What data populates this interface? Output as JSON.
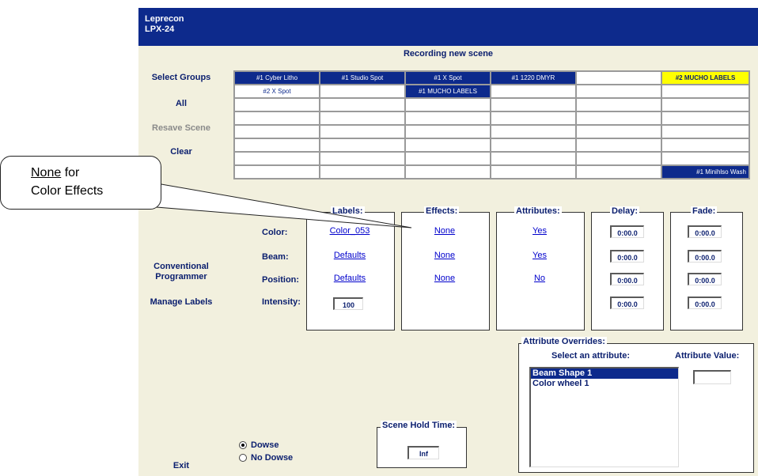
{
  "app": {
    "title_line1": "Leprecon",
    "title_line2": "LPX-24"
  },
  "status": "Recording new scene",
  "sidebar": {
    "select_groups": "Select Groups",
    "all": "All",
    "resave_scene": "Resave Scene",
    "clear": "Clear",
    "conventional_line1": "Conventional",
    "conventional_line2": "Programmer",
    "manage_labels": "Manage Labels",
    "exit": "Exit"
  },
  "groups": {
    "row1": [
      "#1 Cyber Litho",
      "#1 Studio Spot",
      "#1 X Spot",
      "#1 1220 DMYR",
      "",
      "#2 MUCHO LABELS"
    ],
    "row2": [
      "#2 X Spot",
      "",
      "#1 MUCHO LABELS",
      "",
      "",
      ""
    ],
    "last_row_last": "#1 Minihlso Wash"
  },
  "callout": {
    "underlined": "None",
    "line1_rest": " for",
    "line2": "Color Effects"
  },
  "parameters": {
    "headers": {
      "labels": "Labels:",
      "effects": "Effects:",
      "attributes": "Attributes:",
      "delay": "Delay:",
      "fade": "Fade:"
    },
    "rows": [
      {
        "name": "Color:",
        "label": "Color_053",
        "effect": "None",
        "attribute": "Yes",
        "delay": "0:00.0",
        "fade": "0:00.0"
      },
      {
        "name": "Beam:",
        "label": "Defaults",
        "effect": "None",
        "attribute": "Yes",
        "delay": "0:00.0",
        "fade": "0:00.0"
      },
      {
        "name": "Position:",
        "label": "Defaults",
        "effect": "None",
        "attribute": "No",
        "delay": "0:00.0",
        "fade": "0:00.0"
      },
      {
        "name": "Intensity:",
        "label": "100",
        "delay": "0:00.0",
        "fade": "0:00.0"
      }
    ]
  },
  "overrides": {
    "title": "Attribute Overrides:",
    "select_label": "Select an attribute:",
    "value_label": "Attribute Value:",
    "value": "",
    "items": [
      "Beam Shape 1",
      "Color wheel 1"
    ],
    "selected": "Beam Shape 1"
  },
  "hold": {
    "title": "Scene Hold Time:",
    "value": "Inf"
  },
  "dowse": {
    "on": "Dowse",
    "off": "No Dowse",
    "selected": "Dowse"
  },
  "colors": {
    "titlebar": "#0d2a8c",
    "background": "#f2f0de",
    "highlight": "#ffff00",
    "text": "#0a1e6e",
    "link": "#0000cc"
  }
}
